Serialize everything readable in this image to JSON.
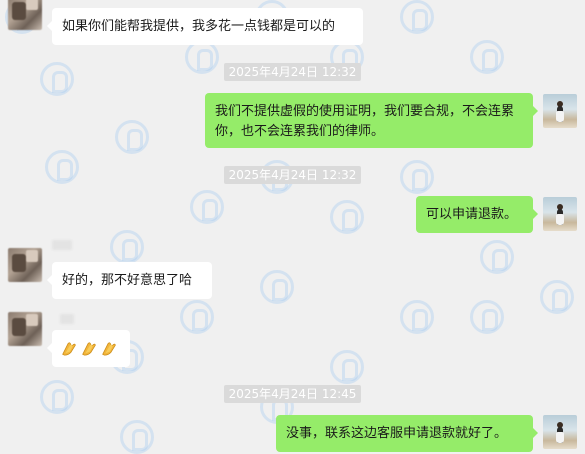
{
  "messages": [
    {
      "side": "in",
      "text": "如果你们能帮我提供，我多花一点钱都是可以的"
    },
    {
      "type": "time",
      "text": "2025年4月24日 12:32"
    },
    {
      "side": "out",
      "text": "我们不提供虚假的使用证明，我们要合规，不会连累你，也不会连累我们的律师。"
    },
    {
      "type": "time",
      "text": "2025年4月24日 12:32"
    },
    {
      "side": "out",
      "text": "可以申请退款。"
    },
    {
      "side": "in",
      "text": "好的，那不好意思了哈"
    },
    {
      "side": "in",
      "emojis": [
        "clap-hands-icon",
        "clap-hands-icon",
        "clap-hands-icon"
      ]
    },
    {
      "type": "time",
      "text": "2025年4月24日 12:45"
    },
    {
      "side": "out",
      "text": "没事，联系这边客服申请退款就好了。"
    }
  ],
  "colors": {
    "background": "#f0f0f0",
    "incoming_bubble": "#ffffff",
    "outgoing_bubble": "#95ec69",
    "timestamp_bg": "#dadada"
  }
}
